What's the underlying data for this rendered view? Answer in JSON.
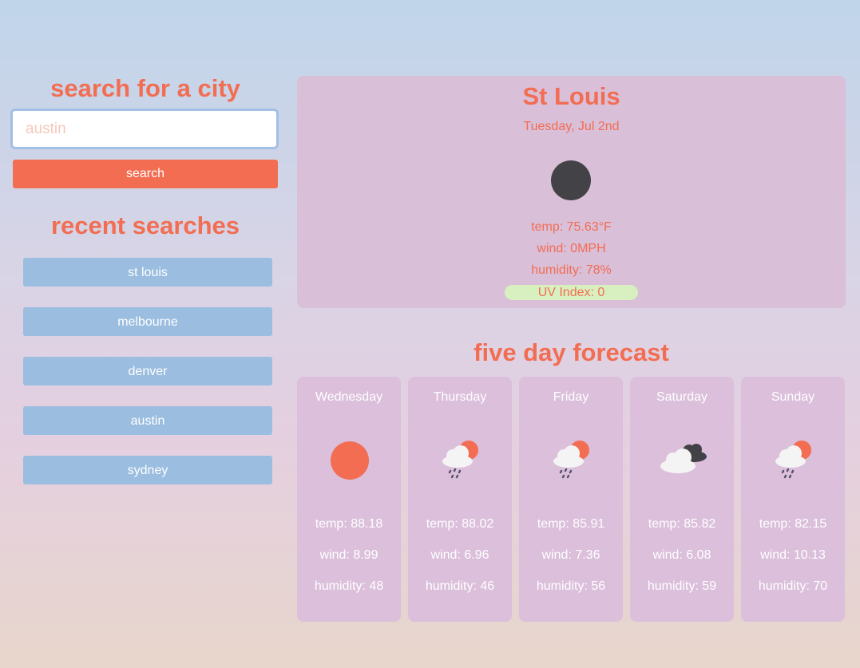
{
  "search": {
    "title": "search for a city",
    "placeholder": "austin",
    "button_label": "search"
  },
  "recent": {
    "title": "recent searches",
    "items": [
      "st louis",
      "melbourne",
      "denver",
      "austin",
      "sydney"
    ]
  },
  "current": {
    "city": "St Louis",
    "date": "Tuesday, Jul 2nd",
    "icon": "moon-icon",
    "temp": "temp: 75.63°F",
    "wind": "wind: 0MPH",
    "humidity": "humidity: 78%",
    "uv": "UV Index: 0",
    "uv_color": "#d8f0c0"
  },
  "forecast": {
    "title": "five day forecast",
    "days": [
      {
        "day": "Wednesday",
        "icon": "sun-icon",
        "temp": "temp: 88.18",
        "wind": "wind: 8.99",
        "humidity": "humidity: 48"
      },
      {
        "day": "Thursday",
        "icon": "sun-rain-cloud-icon",
        "temp": "temp: 88.02",
        "wind": "wind: 6.96",
        "humidity": "humidity: 46"
      },
      {
        "day": "Friday",
        "icon": "sun-rain-cloud-icon",
        "temp": "temp: 85.91",
        "wind": "wind: 7.36",
        "humidity": "humidity: 56"
      },
      {
        "day": "Saturday",
        "icon": "cloudy-icon",
        "temp": "temp: 85.82",
        "wind": "wind: 6.08",
        "humidity": "humidity: 59"
      },
      {
        "day": "Sunday",
        "icon": "sun-rain-cloud-icon",
        "temp": "temp: 82.15",
        "wind": "wind: 10.13",
        "humidity": "humidity: 70"
      }
    ]
  },
  "colors": {
    "accent": "#f26d52",
    "button_blue": "#9bbde0",
    "panel": "#d9bfd8"
  }
}
